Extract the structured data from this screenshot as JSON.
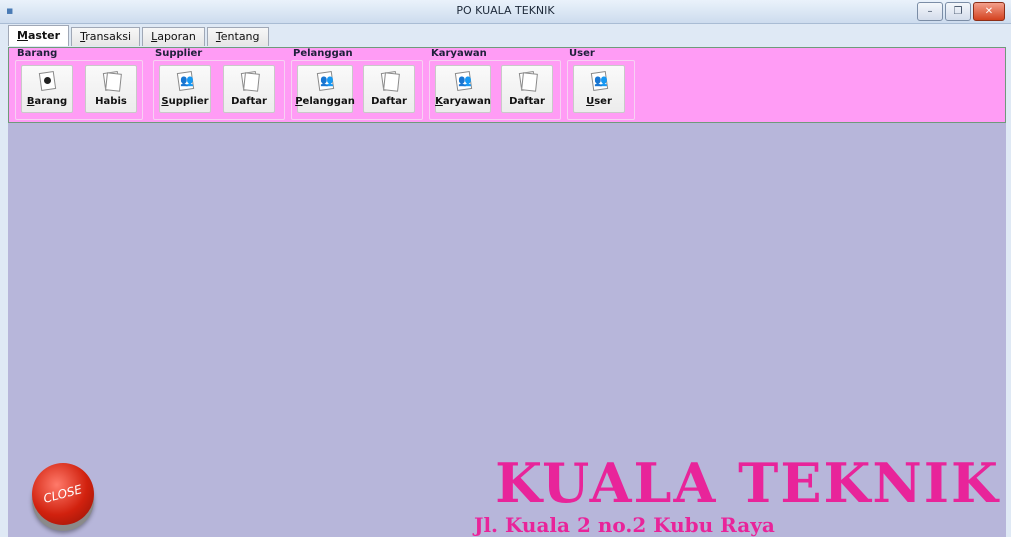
{
  "window": {
    "title": "PO KUALA TEKNIK"
  },
  "tabs": [
    {
      "mnemonic": "M",
      "rest": "aster"
    },
    {
      "mnemonic": "T",
      "rest": "ransaksi"
    },
    {
      "mnemonic": "L",
      "rest": "aporan"
    },
    {
      "mnemonic": "T",
      "rest": "entang"
    }
  ],
  "ribbon": {
    "groups": [
      {
        "label": "Barang",
        "buttons": [
          {
            "mnemonic": "B",
            "rest": "arang",
            "icon": "item-icon"
          },
          {
            "mnemonic": "",
            "rest": "Habis",
            "icon": "list-icon"
          }
        ]
      },
      {
        "label": "Supplier",
        "buttons": [
          {
            "mnemonic": "S",
            "rest": "upplier",
            "icon": "people-icon"
          },
          {
            "mnemonic": "",
            "rest": "Daftar",
            "icon": "list-icon"
          }
        ]
      },
      {
        "label": "Pelanggan",
        "buttons": [
          {
            "mnemonic": "P",
            "rest": "elanggan",
            "icon": "people-icon"
          },
          {
            "mnemonic": "",
            "rest": "Daftar",
            "icon": "list-icon"
          }
        ]
      },
      {
        "label": "Karyawan",
        "buttons": [
          {
            "mnemonic": "K",
            "rest": "aryawan",
            "icon": "people-icon"
          },
          {
            "mnemonic": "",
            "rest": "Daftar",
            "icon": "list-icon"
          }
        ]
      },
      {
        "label": "User",
        "buttons": [
          {
            "mnemonic": "U",
            "rest": "ser",
            "icon": "people-icon"
          }
        ]
      }
    ]
  },
  "brand": {
    "name": "KUALA TEKNIK",
    "address": "Jl. Kuala 2 no.2 Kubu Raya"
  },
  "close_button": {
    "label": "CLOSE"
  },
  "colors": {
    "ribbon": "#ff9cf5",
    "content": "#b7b6da",
    "brand": "#e8249a"
  }
}
